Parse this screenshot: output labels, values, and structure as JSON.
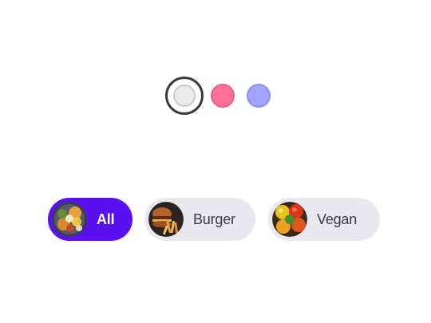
{
  "theme_picker": {
    "swatches": [
      {
        "name": "neutral",
        "color": "#ebebeb",
        "selected": true
      },
      {
        "name": "pink",
        "color": "#ff6f98",
        "selected": false
      },
      {
        "name": "violet",
        "color": "#a3a3ff",
        "selected": false
      }
    ]
  },
  "categories": {
    "items": [
      {
        "label": "All",
        "image": "mixed-food-image",
        "active": true
      },
      {
        "label": "Burger",
        "image": "burger-image",
        "active": false
      },
      {
        "label": "Vegan",
        "image": "vegetables-image",
        "active": false
      }
    ],
    "active_color": "#5a10f0",
    "inactive_color": "#e9e8ee"
  }
}
